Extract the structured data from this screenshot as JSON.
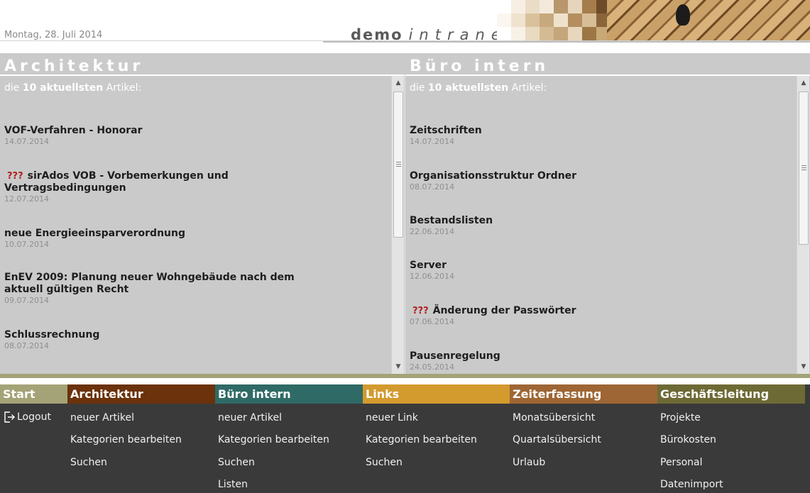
{
  "header": {
    "date": "Montag, 28. Juli 2014",
    "brand_part1": "demo",
    "brand_part2": "intranet"
  },
  "panels": {
    "architektur": {
      "title": "Architektur",
      "subtitle_prefix": "die",
      "subtitle_bold": "10 aktuellsten",
      "subtitle_suffix": "Artikel:",
      "articles": [
        {
          "title": "VOF-Verfahren - Honorar",
          "date": "14.07.2014",
          "flag": ""
        },
        {
          "title": "sirAdos VOB - Vorbemerkungen und Vertragsbedingungen",
          "date": "12.07.2014",
          "flag": "???"
        },
        {
          "title": "neue Energieeinsparverordnung",
          "date": "10.07.2014",
          "flag": ""
        },
        {
          "title": "EnEV 2009: Planung neuer Wohngebäude nach dem aktuell gültigen Recht",
          "date": "09.07.2014",
          "flag": ""
        },
        {
          "title": "Schlussrechnung",
          "date": "08.07.2014",
          "flag": ""
        }
      ]
    },
    "buero": {
      "title": "Büro intern",
      "subtitle_prefix": "die",
      "subtitle_bold": "10 aktuellsten",
      "subtitle_suffix": "Artikel:",
      "articles": [
        {
          "title": "Zeitschriften",
          "date": "14.07.2014",
          "flag": ""
        },
        {
          "title": "Organisationsstruktur Ordner",
          "date": "08.07.2014",
          "flag": ""
        },
        {
          "title": "Bestandslisten",
          "date": "22.06.2014",
          "flag": ""
        },
        {
          "title": "Server",
          "date": "12.06.2014",
          "flag": ""
        },
        {
          "title": "Änderung der Passwörter",
          "date": "07.06.2014",
          "flag": "???"
        },
        {
          "title": "Pausenregelung",
          "date": "24.05.2014",
          "flag": ""
        }
      ]
    }
  },
  "nav": [
    {
      "key": "start",
      "label": "Start",
      "color": "#a4a377",
      "items": [
        "Logout"
      ]
    },
    {
      "key": "architektur",
      "label": "Architektur",
      "color": "#6b320b",
      "items": [
        "neuer Artikel",
        "Kategorien bearbeiten",
        "Suchen"
      ]
    },
    {
      "key": "buero",
      "label": "Büro intern",
      "color": "#2f6a66",
      "items": [
        "neuer Artikel",
        "Kategorien bearbeiten",
        "Suchen",
        "Listen"
      ]
    },
    {
      "key": "links",
      "label": "Links",
      "color": "#d39a2e",
      "items": [
        "neuer Link",
        "Kategorien bearbeiten",
        "Suchen"
      ]
    },
    {
      "key": "zeiterfassung",
      "label": "Zeiterfassung",
      "color": "#9e6634",
      "items": [
        "Monatsübersicht",
        "Quartalsübersicht",
        "Urlaub"
      ]
    },
    {
      "key": "geschaeftsleitung",
      "label": "Geschäftsleitung",
      "color": "#6e6a35",
      "items": [
        "Projekte",
        "Bürokosten",
        "Personal",
        "Datenimport"
      ]
    }
  ],
  "colors": {
    "panel_bg": "#cacaca",
    "nav_bg": "#3a3a3a",
    "warning_flag": "#b02020"
  }
}
